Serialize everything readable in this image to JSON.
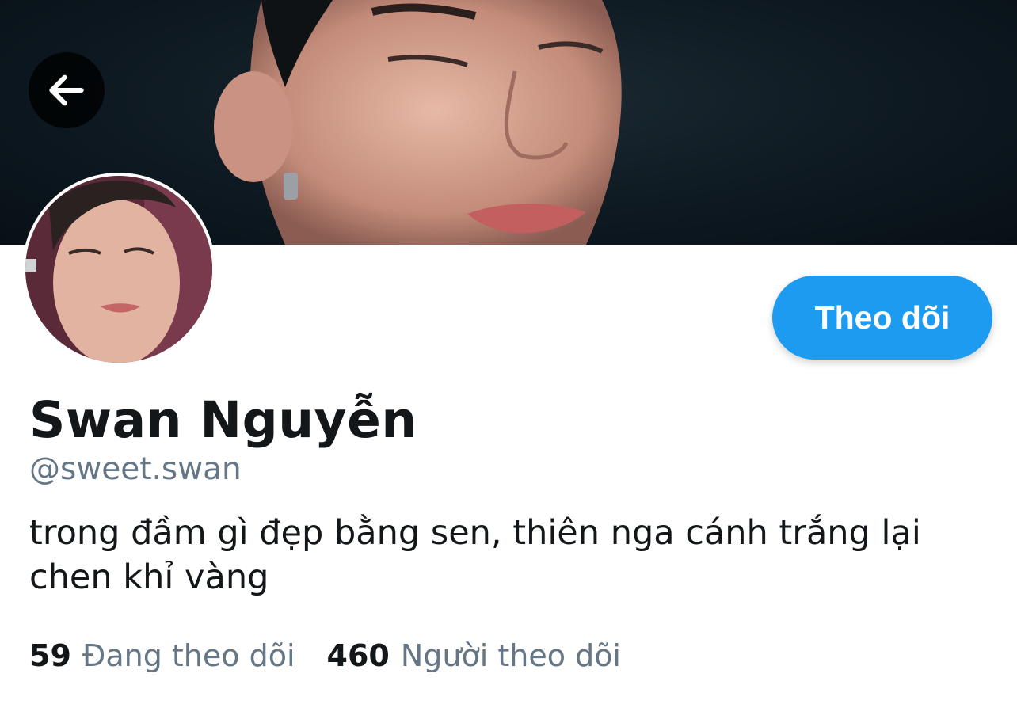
{
  "profile": {
    "display_name": "Swan Nguyễn",
    "handle": "@sweet.swan",
    "bio": "trong đầm gì đẹp bằng sen, thiên nga cánh trắng lại chen khỉ vàng",
    "follow_button_label": "Theo dõi"
  },
  "stats": [
    {
      "count": "59",
      "label": "Đang theo dõi"
    },
    {
      "count": "460",
      "label": "Người theo dõi"
    }
  ],
  "icons": {
    "back": "arrow-left-icon"
  },
  "colors": {
    "accent": "#1d9bf0",
    "text_primary": "#14171a",
    "text_secondary": "#657786",
    "background": "#ffffff"
  }
}
